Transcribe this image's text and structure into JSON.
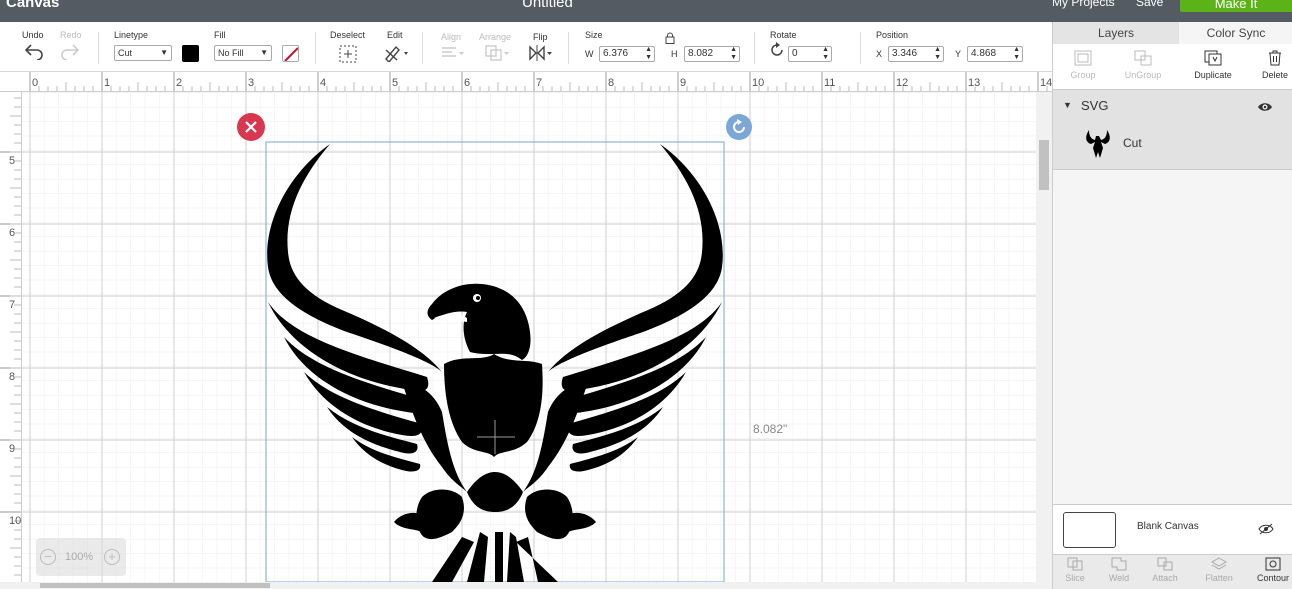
{
  "topbar": {
    "app_title": "Canvas",
    "document_title": "Untitled",
    "my_projects": "My Projects",
    "save": "Save",
    "make_it": "Make It"
  },
  "toolbar": {
    "undo": "Undo",
    "redo": "Redo",
    "linetype_label": "Linetype",
    "linetype_value": "Cut",
    "fill_label": "Fill",
    "fill_value": "No Fill",
    "deselect": "Deselect",
    "edit": "Edit",
    "align": "Align",
    "arrange": "Arrange",
    "flip": "Flip",
    "size_label": "Size",
    "w_label": "W",
    "w_value": "6.376",
    "h_label": "H",
    "h_value": "8.082",
    "rotate_label": "Rotate",
    "rotate_value": "0",
    "position_label": "Position",
    "x_label": "X",
    "x_value": "3.346",
    "y_label": "Y",
    "y_value": "4.868",
    "linetype_color": "#000000",
    "fill_color": "#ffffff"
  },
  "rulers": {
    "top": [
      "0",
      "1",
      "2",
      "3",
      "4",
      "5",
      "6",
      "7",
      "8",
      "9",
      "10",
      "11",
      "12",
      "13",
      "14"
    ],
    "left": [
      "5",
      "6",
      "7",
      "8",
      "9",
      "10"
    ]
  },
  "canvas": {
    "height_dimension": "8.082\"",
    "zoom": "100%",
    "delete_handle_color": "#d9364f",
    "rotate_handle_color": "#7ba7d6",
    "selection_color": "#7aa6d1"
  },
  "panel": {
    "tabs": [
      "Layers",
      "Color Sync"
    ],
    "tools": {
      "group": "Group",
      "ungroup": "UnGroup",
      "duplicate": "Duplicate",
      "delete": "Delete"
    },
    "layer_group_name": "SVG",
    "layer_item_name": "Cut",
    "blank_canvas": "Blank Canvas",
    "bottom_tools": [
      "Slice",
      "Weld",
      "Attach",
      "Flatten",
      "Contour"
    ]
  }
}
